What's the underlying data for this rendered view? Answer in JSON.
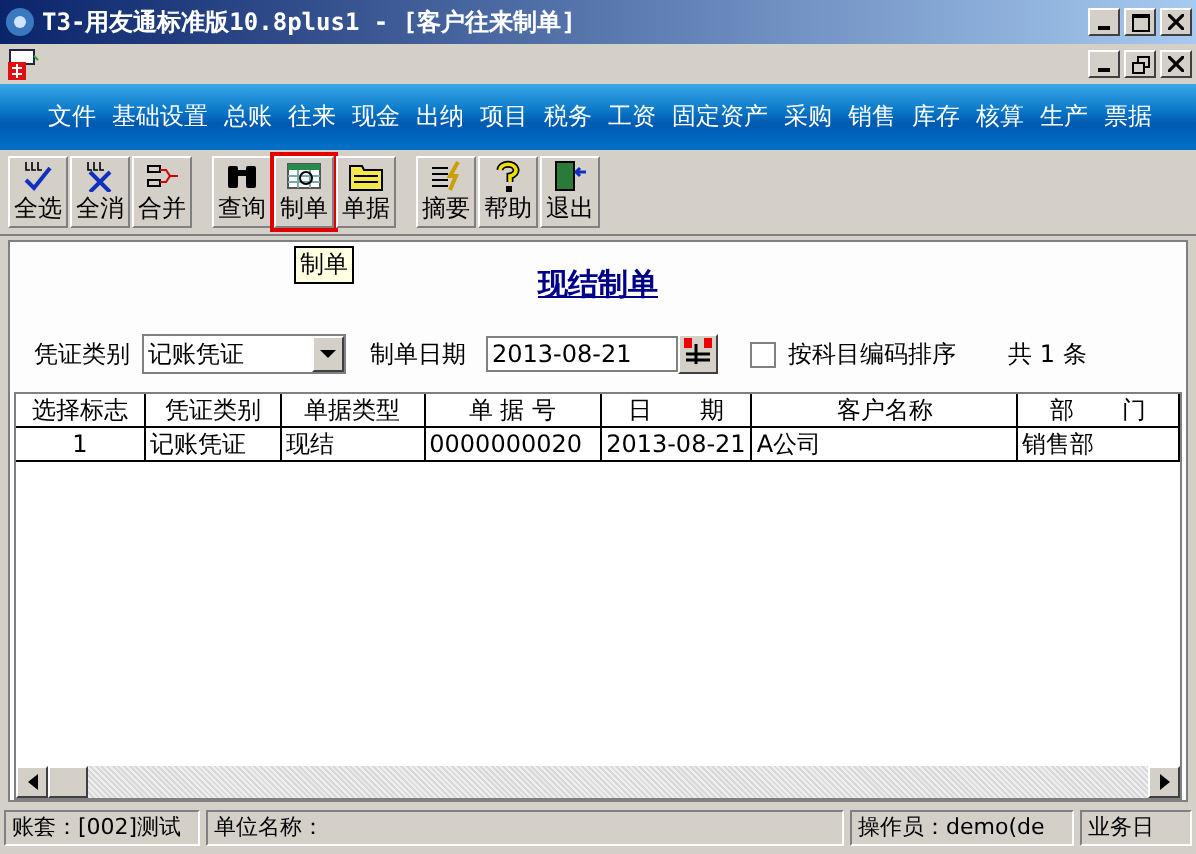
{
  "window": {
    "title": "T3-用友通标准版10.8plus1 - [客户往来制单]"
  },
  "menu": [
    "文件",
    "基础设置",
    "总账",
    "往来",
    "现金",
    "出纳",
    "项目",
    "税务",
    "工资",
    "固定资产",
    "采购",
    "销售",
    "库存",
    "核算",
    "生产",
    "票据"
  ],
  "toolbar": [
    {
      "label": "全选",
      "kind": "check",
      "highlighted": false
    },
    {
      "label": "全消",
      "kind": "uncheck",
      "highlighted": false
    },
    {
      "label": "合并",
      "kind": "merge",
      "highlighted": false
    },
    {
      "label": "查询",
      "kind": "binoculars",
      "highlighted": false
    },
    {
      "label": "制单",
      "kind": "grid",
      "highlighted": true
    },
    {
      "label": "单据",
      "kind": "folder",
      "highlighted": false
    },
    {
      "label": "摘要",
      "kind": "lines",
      "highlighted": false
    },
    {
      "label": "帮助",
      "kind": "help",
      "highlighted": false
    },
    {
      "label": "退出",
      "kind": "exit",
      "highlighted": false
    }
  ],
  "tooltip": "制单",
  "heading": "现结制单",
  "filters": {
    "voucher_type_label": "凭证类别",
    "voucher_type": "记账凭证",
    "date_label": "制单日期",
    "date": "2013-08-21",
    "sort_label": "按科目编码排序",
    "sort_checked": false,
    "count": "共 1 条"
  },
  "table": {
    "columns": [
      "选择标志",
      "凭证类别",
      "单据类型",
      "单 据 号",
      "日　　期",
      "客户名称",
      "部　　门"
    ],
    "rows": [
      [
        "1",
        "记账凭证",
        "现结",
        "0000000020",
        "2013-08-21",
        "A公司",
        "销售部"
      ]
    ]
  },
  "status_bar": [
    "账套：[002]测试",
    "单位名称：",
    "操作员：demo(de",
    "业务日"
  ]
}
